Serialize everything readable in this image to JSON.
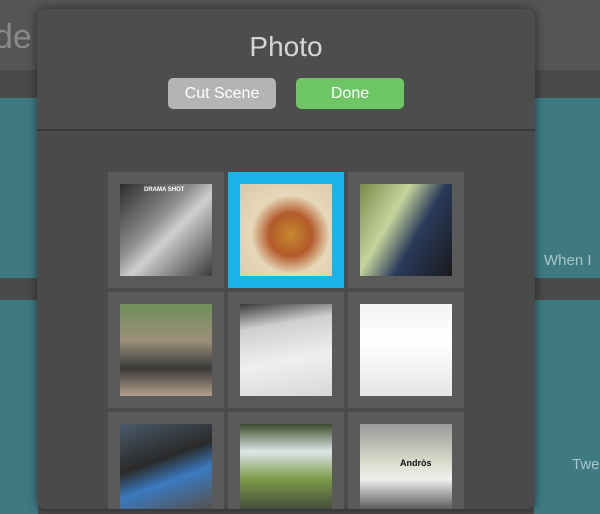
{
  "background": {
    "header_text": "de",
    "labels": {
      "when": "When I",
      "tweet": "Twe"
    }
  },
  "modal": {
    "title": "Photo",
    "buttons": {
      "cut_scene": "Cut Scene",
      "done": "Done"
    }
  },
  "photos": [
    {
      "name": "photo-drama-shot",
      "selected": false,
      "caption": "DRAMA SHOT"
    },
    {
      "name": "photo-food-plate",
      "selected": true
    },
    {
      "name": "photo-phone-case",
      "selected": false
    },
    {
      "name": "photo-group",
      "selected": false
    },
    {
      "name": "photo-document",
      "selected": false
    },
    {
      "name": "photo-webpage",
      "selected": false
    },
    {
      "name": "photo-smartphone-hand",
      "selected": false
    },
    {
      "name": "photo-presentation",
      "selected": false
    },
    {
      "name": "photo-mug",
      "selected": false,
      "caption": "Andròs"
    }
  ],
  "colors": {
    "accent_selected": "#19b5ea",
    "done_button": "#6fc665",
    "cut_button": "#b4b4b4"
  }
}
